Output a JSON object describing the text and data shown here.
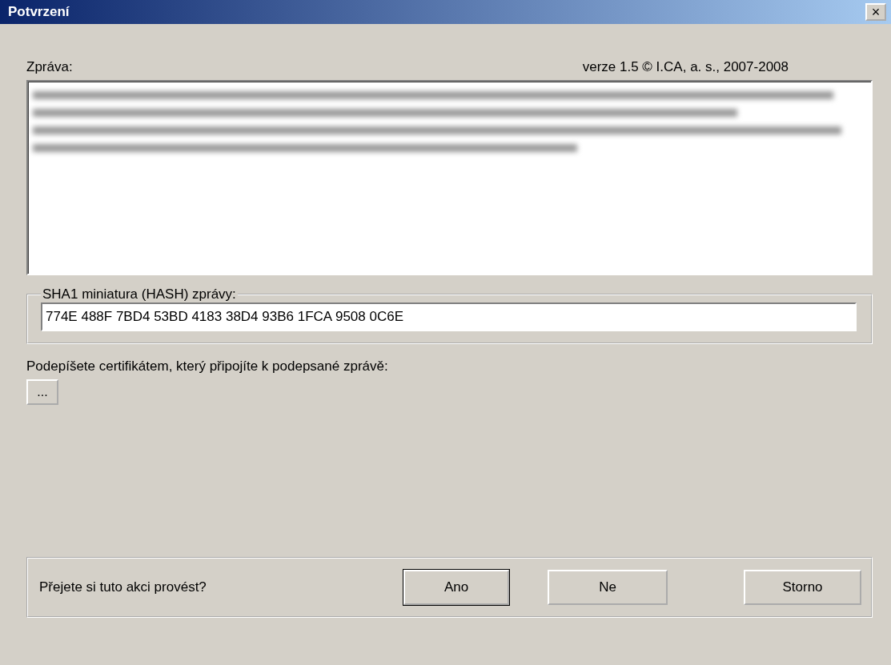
{
  "window": {
    "title": "Potvrzení",
    "close": "×"
  },
  "message": {
    "label": "Zpráva:",
    "version": "verze 1.5 © I.CA, a. s., 2007-2008",
    "blurred": true
  },
  "hash": {
    "legend": "SHA1 miniatura (HASH) zprávy:",
    "value": "774E 488F 7BD4 53BD 4183 38D4 93B6 1FCA 9508 0C6E"
  },
  "certificate": {
    "label": "Podepíšete certifikátem, který připojíte k podepsané zprávě:",
    "browse": "..."
  },
  "confirm": {
    "question": "Přejete si tuto akci provést?",
    "buttons": [
      {
        "label": "Ano",
        "default": true
      },
      {
        "label": "Ne",
        "default": false
      },
      {
        "label": "Storno",
        "default": false
      }
    ]
  }
}
